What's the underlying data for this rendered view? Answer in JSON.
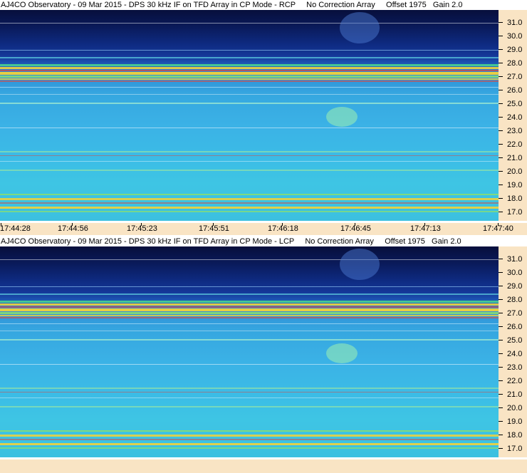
{
  "panels": [
    {
      "title": "AJ4CO Observatory - 09 Mar 2015 - DPS 30 kHz IF on TFD Array in CP Mode - RCP     No Correction Array     Offset 1975   Gain 2.0",
      "y_ticks": [
        "31.0",
        "30.0",
        "29.0",
        "28.0",
        "27.0",
        "26.0",
        "25.0",
        "24.0",
        "23.0",
        "22.0",
        "21.0",
        "20.0",
        "19.0",
        "18.0",
        "17.0"
      ]
    },
    {
      "title": "AJ4CO Observatory - 09 Mar 2015 - DPS 30 kHz IF on TFD Array in CP Mode - LCP     No Correction Array     Offset 1975   Gain 2.0",
      "y_ticks": [
        "31.0",
        "30.0",
        "29.0",
        "28.0",
        "27.0",
        "26.0",
        "25.0",
        "24.0",
        "23.0",
        "22.0",
        "21.0",
        "20.0",
        "19.0",
        "18.0",
        "17.0"
      ]
    }
  ],
  "time_axis": [
    "17:44:28",
    "17:44:56",
    "17:45:23",
    "17:45:51",
    "17:46:18",
    "17:46:45",
    "17:47:13",
    "17:47:40"
  ],
  "colors": {
    "axis_background": "#f9e4c4",
    "spectrogram_low": "#070f3c",
    "spectrogram_high": "#3cc0e0",
    "band_yellow": "#f2d23a",
    "band_red": "#e0443a"
  }
}
